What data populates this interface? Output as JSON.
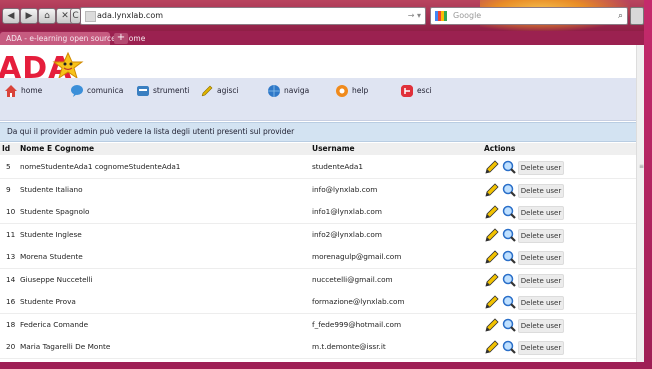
{
  "browser": {
    "url": "ada.lynxlab.com",
    "tab_title": "ADA - e-learning open source - Home",
    "search_placeholder": "Google",
    "new_tab": "+",
    "nav_glyphs": {
      "back": "◀",
      "forward": "▶",
      "home": "⌂",
      "stop": "✕",
      "reload": "C"
    },
    "url_arrows": "→ ▾",
    "search_glyph": "⌕"
  },
  "app": {
    "logo": "ADA",
    "menu": [
      {
        "label": "home",
        "icon": "home-icon",
        "color": "#d9433a"
      },
      {
        "label": "comunica",
        "icon": "chat-bubble-icon",
        "color": "#3b8fd9"
      },
      {
        "label": "strumenti",
        "icon": "tools-icon",
        "color": "#3a7fc1"
      },
      {
        "label": "agisci",
        "icon": "pencil-icon",
        "color": "#e0b400"
      },
      {
        "label": "naviga",
        "icon": "globe-icon",
        "color": "#2f78c8"
      },
      {
        "label": "help",
        "icon": "lifebuoy-icon",
        "color": "#f08a1c"
      },
      {
        "label": "esci",
        "icon": "exit-icon",
        "color": "#e0303a"
      }
    ],
    "info": "Da qui il provider admin può vedere la lista degli utenti presenti sul provider"
  },
  "table": {
    "headers": {
      "id": "Id",
      "name": "Nome E Cognome",
      "username": "Username",
      "actions": "Actions"
    },
    "delete_label": "Delete user",
    "rows": [
      {
        "id": "5",
        "name": "nomeStudenteAda1 cognomeStudenteAda1",
        "username": "studenteAda1"
      },
      {
        "id": "9",
        "name": "Studente Italiano",
        "username": "info@lynxlab.com"
      },
      {
        "id": "10",
        "name": "Studente Spagnolo",
        "username": "info1@lynxlab.com"
      },
      {
        "id": "11",
        "name": "Studente Inglese",
        "username": "info2@lynxlab.com"
      },
      {
        "id": "13",
        "name": "Morena Studente",
        "username": "morenagulp@gmail.com"
      },
      {
        "id": "14",
        "name": "Giuseppe Nuccetelli",
        "username": "nuccetelli@gmail.com"
      },
      {
        "id": "16",
        "name": "Studente Prova",
        "username": "formazione@lynxlab.com"
      },
      {
        "id": "18",
        "name": "Federica Comande",
        "username": "f_fede999@hotmail.com"
      },
      {
        "id": "20",
        "name": "Maria Tagarelli De Monte",
        "username": "m.t.demonte@issr.it"
      }
    ]
  }
}
